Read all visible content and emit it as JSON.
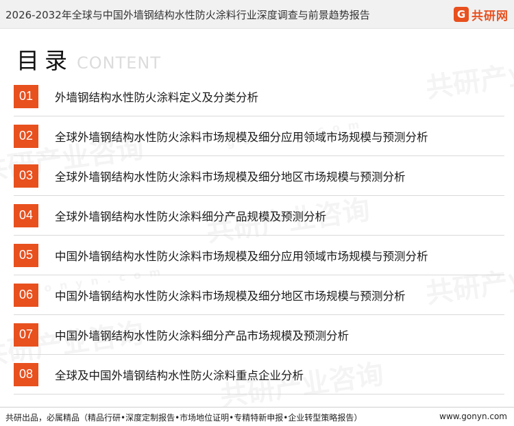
{
  "header": {
    "title": "2026-2032年全球与中国外墙钢结构水性防火涂料行业深度调查与前景趋势报告",
    "logo_mark": "G",
    "logo_text": "共研网"
  },
  "toc": {
    "title": "目录",
    "subtitle": "CONTENT"
  },
  "items": [
    {
      "num": "01",
      "label": "外墙钢结构水性防火涂料定义及分类分析"
    },
    {
      "num": "02",
      "label": "全球外墙钢结构水性防火涂料市场规模及细分应用领域市场规模与预测分析"
    },
    {
      "num": "03",
      "label": "全球外墙钢结构水性防火涂料市场规模及细分地区市场规模与预测分析"
    },
    {
      "num": "04",
      "label": "全球外墙钢结构水性防火涂料细分产品规模及预测分析"
    },
    {
      "num": "05",
      "label": "中国外墙钢结构水性防火涂料市场规模及细分应用领域市场规模与预测分析"
    },
    {
      "num": "06",
      "label": "中国外墙钢结构水性防火涂料市场规模及细分地区市场规模与预测分析"
    },
    {
      "num": "07",
      "label": "中国外墙钢结构水性防火涂料细分产品市场规模及预测分析"
    },
    {
      "num": "08",
      "label": "全球及中国外墙钢结构水性防火涂料重点企业分析"
    }
  ],
  "footer": {
    "left": "共研出品，必属精品（精品行研•深度定制报告•市场地位证明•专精特新申报•企业转型策略报告）",
    "right": "www.gonyn.com"
  },
  "watermark": {
    "text": "共研产业咨询",
    "url": "gonyn.com"
  },
  "colors": {
    "accent": "#e8501e",
    "divider": "#d9d9d9"
  }
}
